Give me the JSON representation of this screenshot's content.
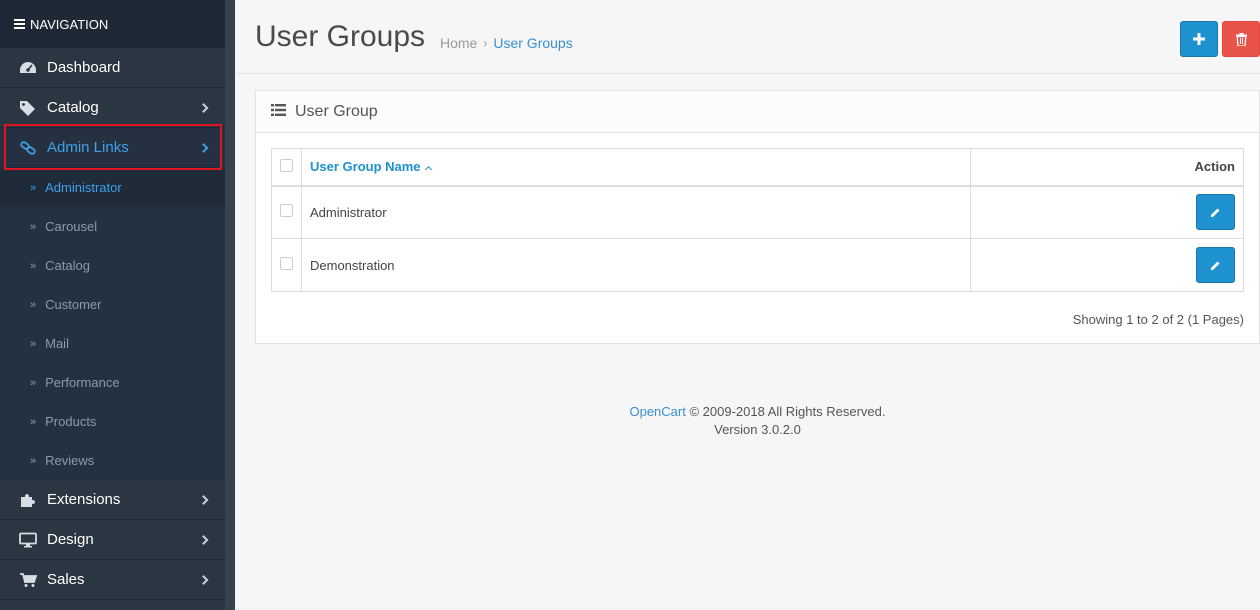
{
  "sidebar": {
    "header": "NAVIGATION",
    "items": [
      {
        "label": "Dashboard",
        "icon": "dashboard-icon"
      },
      {
        "label": "Catalog",
        "icon": "tags-icon"
      },
      {
        "label": "Admin Links",
        "icon": "link-icon"
      },
      {
        "label": "Extensions",
        "icon": "puzzle-icon"
      },
      {
        "label": "Design",
        "icon": "monitor-icon"
      },
      {
        "label": "Sales",
        "icon": "cart-icon"
      }
    ],
    "sub_items": [
      "Administrator",
      "Carousel",
      "Catalog",
      "Customer",
      "Mail",
      "Performance",
      "Products",
      "Reviews"
    ]
  },
  "header": {
    "title": "User Groups",
    "breadcrumb_home": "Home",
    "breadcrumb_current": "User Groups"
  },
  "panel": {
    "title": "User Group",
    "col_name": "User Group Name",
    "col_action": "Action",
    "rows": [
      {
        "name": "Administrator"
      },
      {
        "name": "Demonstration"
      }
    ],
    "showing": "Showing 1 to 2 of 2 (1 Pages)"
  },
  "footer": {
    "brand": "OpenCart",
    "copyright": " © 2009-2018 All Rights Reserved.",
    "version": "Version 3.0.2.0"
  },
  "colors": {
    "accent": "#1e91cf",
    "danger": "#e8534a",
    "sidebar_bg": "#2b3643",
    "highlight": "#e0141e"
  }
}
